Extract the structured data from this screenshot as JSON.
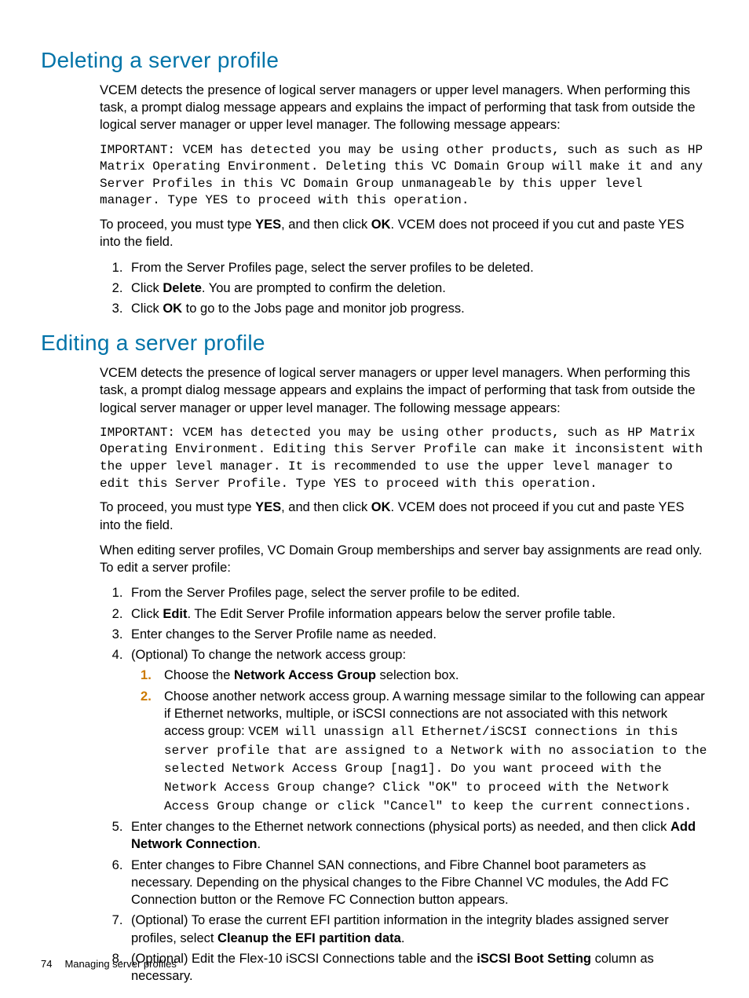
{
  "doc": {
    "page_number": "74",
    "footer_text": "Managing server profiles",
    "sections": {
      "delete": {
        "title": "Deleting a server profile",
        "p1": "VCEM detects the presence of logical server managers or upper level managers. When performing this task, a prompt dialog message appears and explains the impact of performing that task from outside the logical server manager or upper level manager. The following message appears:",
        "msg": "IMPORTANT: VCEM has detected you may be using other products, such as such as HP Matrix Operating Environment. Deleting this VC Domain Group will make it and any Server Profiles in this VC Domain Group unmanageable by this upper level manager. Type YES to proceed with this operation.",
        "p2a": "To proceed, you must type ",
        "p2_yes": "YES",
        "p2b": ", and then click ",
        "p2_ok": "OK",
        "p2c": ". VCEM does not proceed if you cut and paste YES into the field.",
        "step1": "From the Server Profiles page, select the server profiles to be deleted.",
        "step2a": "Click ",
        "step2_bold": "Delete",
        "step2b": ". You are prompted to confirm the deletion.",
        "step3a": "Click ",
        "step3_bold": "OK",
        "step3b": " to go to the Jobs page and monitor job progress."
      },
      "edit": {
        "title": "Editing a server profile",
        "p1": "VCEM detects the presence of logical server managers or upper level managers. When performing this task, a prompt dialog message appears and explains the impact of performing that task from outside the logical server manager or upper level manager. The following message appears:",
        "msg": "IMPORTANT: VCEM has detected you may be using other products, such as HP Matrix Operating Environment. Editing this Server Profile can make it inconsistent with the upper level manager. It is recommended to use the upper level manager to edit this Server Profile. Type YES to proceed with this operation.",
        "p2a": "To proceed, you must type ",
        "p2_yes": "YES",
        "p2b": ", and then click ",
        "p2_ok": "OK",
        "p2c": ". VCEM does not proceed if you cut and paste YES into the field.",
        "p3": "When editing server profiles, VC Domain Group memberships and server bay assignments are read only. To edit a server profile:",
        "step1": "From the Server Profiles page, select the server profile to be edited.",
        "step2a": "Click ",
        "step2_bold": "Edit",
        "step2b": ". The Edit Server Profile information appears below the server profile table.",
        "step3": "Enter changes to the Server Profile name as needed.",
        "step4": "(Optional) To change the network access group:",
        "sub1a": "Choose the ",
        "sub1_bold": "Network Access Group",
        "sub1b": " selection box.",
        "sub2a": "Choose another network access group. A warning message similar to the following can appear if Ethernet networks, multiple, or iSCSI connections are not associated with this network access group: ",
        "sub2_mono": "VCEM will unassign all Ethernet/iSCSI connections in this server profile that are assigned to a Network with no association to the selected Network Access Group [nag1]. Do you want proceed with the Network Access Group change? Click \"OK\" to proceed with the Network Access Group change or click \"Cancel\" to keep the current connections.",
        "step5a": "Enter changes to the Ethernet network connections (physical ports) as needed, and then click ",
        "step5_bold": "Add Network Connection",
        "step5b": ".",
        "step6": "Enter changes to Fibre Channel SAN connections, and Fibre Channel boot parameters as necessary. Depending on the physical changes to the Fibre Channel VC modules, the Add FC Connection button or the Remove FC Connection button appears.",
        "step7a": "(Optional) To erase the current EFI partition information in the integrity blades assigned server profiles, select ",
        "step7_bold": "Cleanup the EFI partition data",
        "step7b": ".",
        "step8a": "(Optional) Edit the Flex-10 iSCSI Connections table and the ",
        "step8_bold": "iSCSI Boot Setting",
        "step8b": " column as necessary."
      }
    }
  }
}
